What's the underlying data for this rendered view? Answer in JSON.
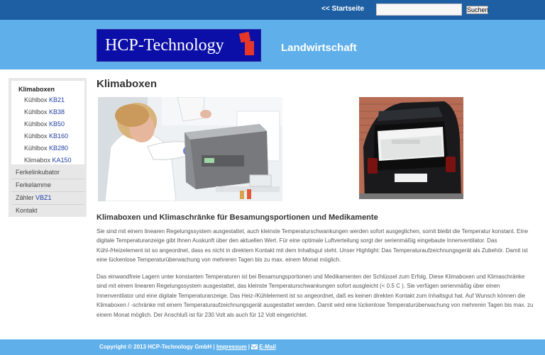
{
  "topbar": {
    "home_link": "<< Startseite",
    "search_placeholder": "",
    "search_button": "Suchen"
  },
  "header": {
    "logo_text": "HCP-Technology",
    "tagline": "Landwirtschaft"
  },
  "sidebar": {
    "heading": "Klimaboxen",
    "sub_items": [
      {
        "label": "Kühlbox ",
        "code": "KB21"
      },
      {
        "label": "Kühlbox ",
        "code": "KB38"
      },
      {
        "label": "Kühlbox ",
        "code": "KB50"
      },
      {
        "label": "Kühlbox ",
        "code": "KB160"
      },
      {
        "label": "Kühlbox ",
        "code": "KB280"
      },
      {
        "label": "Klimabox ",
        "code": "KA150"
      }
    ],
    "main_items": [
      {
        "label": "Ferkelinkubator",
        "code": ""
      },
      {
        "label": "Ferkelamme",
        "code": ""
      },
      {
        "label": "Zähler ",
        "code": "VBZ1"
      },
      {
        "label": "Kontakt",
        "code": ""
      }
    ]
  },
  "content": {
    "title": "Klimaboxen",
    "subtitle": "Klimaboxen und Klimaschränke für Besamungsportionen und Medikamente",
    "para1": "Sie sind mit einem linearen Regelungssystem ausgestattet, auch kleinste Temperaturschwankungen werden sofort ausgeglichen, somit bleibt die Temperatur konstant. Eine digitale Temperaturanzeige gibt Ihnen Auskunft über den aktuellen Wert. Für eine optimale Luftverteilung sorgt der serienmäßig eingebaute Innenventilator. Das Kühl-/Heizelement ist so angeordnet, dass es nicht in direktem Kontakt mit dem Inhaltsgut steht. Unser Highlight: Das Temperaturaufzeichnungsgerät als Zubehör. Damit ist eine lückenlose Temperaturüberwachung von mehreren Tagen bis zu max. einem Monat möglich.",
    "para2": "Das einwandfreie Lagern unter konstanten Temperaturen ist bei Besamungsportionen und Medikamenten der Schlüssel zum Erfolg. Diese Klimaboxen und Klimaschränke sind mit einem linearen Regelungssystem ausgestattet, das kleinste Temperaturschwankungen sofort ausgleicht (< 0.5 C ). Sie verfügen serienmäßig über einen Innenventilator und eine digitale Temperaturanzeige. Das Heiz-/Kühlelement ist so angeordnet, daß es keinen direkten Kontakt zum Inhaltsgut hat. Auf Wunsch können die Klimaboxen / -schränke mit einem Temperaturaufzeichnungsgerät ausgestattet werden. Damit wird eine lückenlose Temperaturüberwachung von mehreren Tagen bis max. zu einem Monat möglich. Der Anschluß ist für 230 Volt als auch für 12 Volt eingerichtet."
  },
  "footer": {
    "copyright": "Copyright © 2013 HCP-Technology GmbH | ",
    "impressum": "Impressum",
    "separator": " | ",
    "email": "E-Mail"
  },
  "colors": {
    "topbar": "#1e5fa3",
    "header": "#5fb0ea",
    "logo_bg": "#0c0ea8",
    "logo_accent": "#e53628",
    "nav_code": "#1e3fa3"
  }
}
